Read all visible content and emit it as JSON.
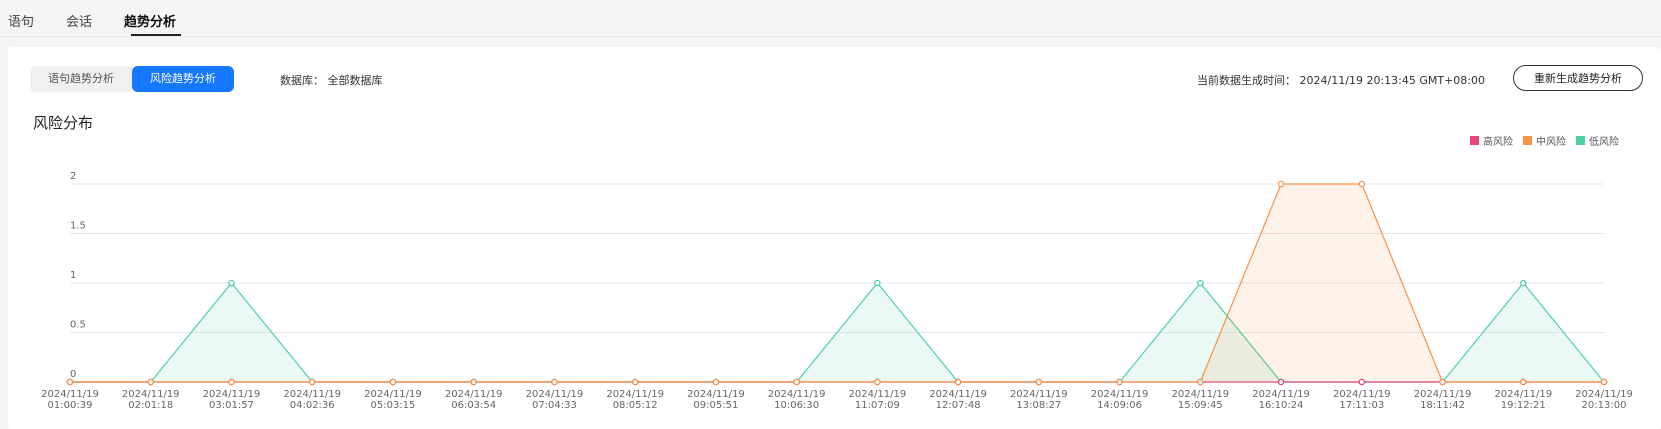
{
  "tabs": [
    {
      "label": "语句"
    },
    {
      "label": "会话"
    },
    {
      "label": "趋势分析",
      "active": true
    }
  ],
  "segmented": [
    {
      "label": "语句趋势分析"
    },
    {
      "label": "风险趋势分析",
      "active": true
    }
  ],
  "database": {
    "text": "数据库：  全部数据库"
  },
  "generated": {
    "text": "当前数据生成时间：  2024/11/19 20:13:45 GMT+08:00"
  },
  "regen_button": "重新生成趋势分析",
  "accent_color": "#1677ff",
  "chart_data": {
    "type": "area",
    "title": "风险分布",
    "xlabel": "",
    "ylabel": "",
    "ylim": [
      0,
      2
    ],
    "yticks": [
      0,
      0.5,
      1,
      1.5,
      2
    ],
    "grid": true,
    "legend_position": "top-right",
    "categories": [
      [
        "2024/11/19",
        "01:00:39"
      ],
      [
        "2024/11/19",
        "02:01:18"
      ],
      [
        "2024/11/19",
        "03:01:57"
      ],
      [
        "2024/11/19",
        "04:02:36"
      ],
      [
        "2024/11/19",
        "05:03:15"
      ],
      [
        "2024/11/19",
        "06:03:54"
      ],
      [
        "2024/11/19",
        "07:04:33"
      ],
      [
        "2024/11/19",
        "08:05:12"
      ],
      [
        "2024/11/19",
        "09:05:51"
      ],
      [
        "2024/11/19",
        "10:06:30"
      ],
      [
        "2024/11/19",
        "11:07:09"
      ],
      [
        "2024/11/19",
        "12:07:48"
      ],
      [
        "2024/11/19",
        "13:08:27"
      ],
      [
        "2024/11/19",
        "14:09:06"
      ],
      [
        "2024/11/19",
        "15:09:45"
      ],
      [
        "2024/11/19",
        "16:10:24"
      ],
      [
        "2024/11/19",
        "17:11:03"
      ],
      [
        "2024/11/19",
        "18:11:42"
      ],
      [
        "2024/11/19",
        "19:12:21"
      ],
      [
        "2024/11/19",
        "20:13:00"
      ]
    ],
    "series": [
      {
        "name": "高风险",
        "color": "#e8457a",
        "values": [
          0,
          0,
          0,
          0,
          0,
          0,
          0,
          0,
          0,
          0,
          0,
          0,
          0,
          0,
          0,
          0,
          0,
          0,
          0,
          0
        ]
      },
      {
        "name": "中风险",
        "color": "#f7924a",
        "values": [
          0,
          0,
          0,
          0,
          0,
          0,
          0,
          0,
          0,
          0,
          0,
          0,
          0,
          0,
          0,
          2,
          2,
          0,
          0,
          0
        ]
      },
      {
        "name": "低风险",
        "color": "#4fd0a8",
        "values": [
          0,
          0,
          1,
          0,
          0,
          0,
          0,
          0,
          0,
          0,
          1,
          0,
          0,
          0,
          1,
          0,
          0,
          0,
          1,
          0
        ]
      }
    ]
  }
}
